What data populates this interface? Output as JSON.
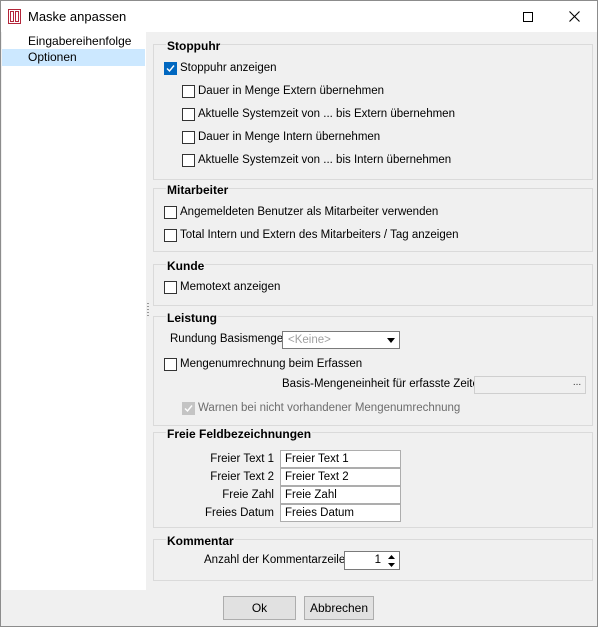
{
  "window": {
    "title": "Maske anpassen"
  },
  "sidebar": {
    "items": [
      {
        "label": "Eingabereihenfolge"
      },
      {
        "label": "Optionen"
      }
    ]
  },
  "groups": {
    "stoppuhr": {
      "title": "Stoppuhr",
      "show_stopwatch": "Stoppuhr anzeigen",
      "options": [
        "Dauer in Menge Extern übernehmen",
        "Aktuelle Systemzeit von ... bis Extern übernehmen",
        "Dauer in Menge Intern übernehmen",
        "Aktuelle Systemzeit von ... bis Intern übernehmen"
      ]
    },
    "mitarbeiter": {
      "title": "Mitarbeiter",
      "options": [
        "Angemeldeten Benutzer als Mitarbeiter verwenden",
        "Total Intern und Extern des Mitarbeiters / Tag anzeigen"
      ]
    },
    "kunde": {
      "title": "Kunde",
      "options": [
        "Memotext anzeigen"
      ]
    },
    "leistung": {
      "title": "Leistung",
      "rounding_label": "Rundung Basismenge",
      "rounding_value": "<Keine>",
      "conversion": "Mengenumrechnung beim Erfassen",
      "base_unit_label": "Basis-Mengeneinheit für erfasste Zeiten",
      "ellipsis": "...",
      "warn": "Warnen bei nicht vorhandener Mengenumrechnung"
    },
    "freie": {
      "title": "Freie Feldbezeichnungen",
      "fields": [
        {
          "label": "Freier Text 1",
          "value": "Freier Text 1"
        },
        {
          "label": "Freier Text 2",
          "value": "Freier Text 2"
        },
        {
          "label": "Freie Zahl",
          "value": "Freie Zahl"
        },
        {
          "label": "Freies Datum",
          "value": "Freies Datum"
        }
      ]
    },
    "kommentar": {
      "title": "Kommentar",
      "lines_label": "Anzahl der Kommentarzeilen",
      "lines_value": "1"
    }
  },
  "buttons": {
    "ok": "Ok",
    "cancel": "Abbrechen"
  },
  "colors": {
    "accent": "#0067c0",
    "selection": "#cce8ff"
  }
}
